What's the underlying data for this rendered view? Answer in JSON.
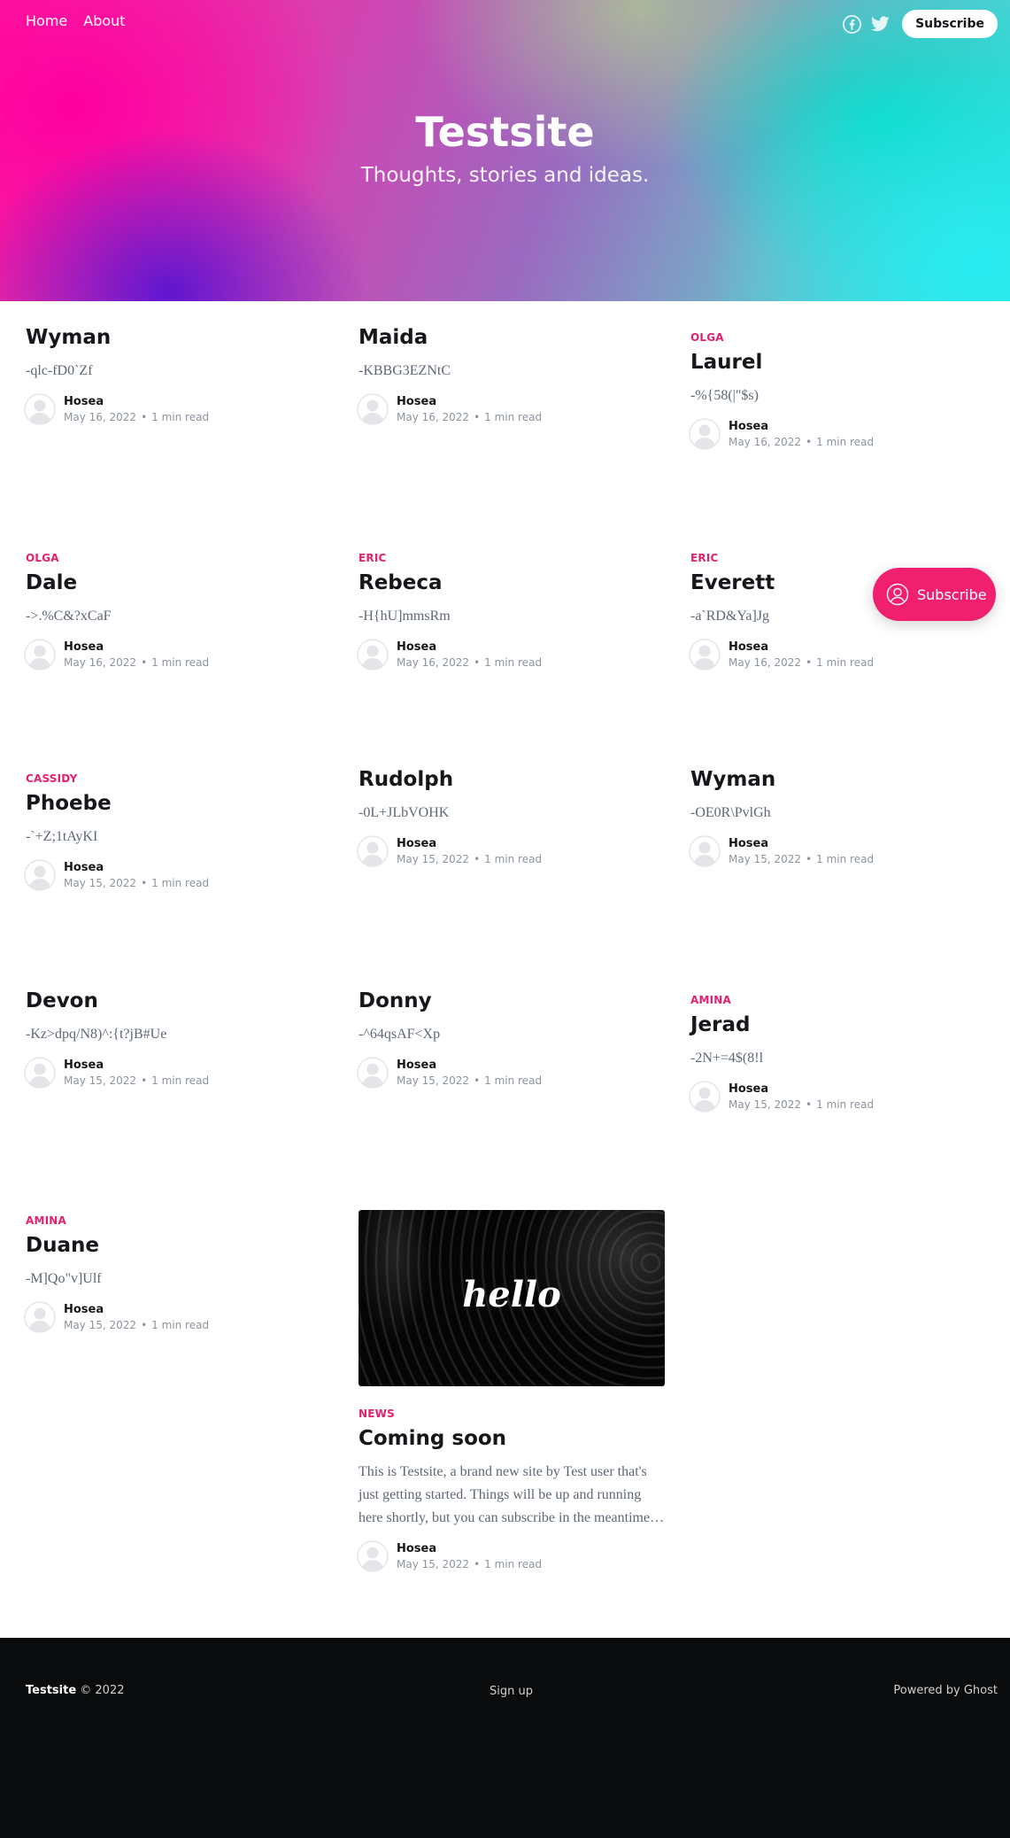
{
  "nav": {
    "home": "Home",
    "about": "About",
    "subscribe": "Subscribe"
  },
  "site": {
    "title": "Testsite",
    "description": "Thoughts, stories and ideas."
  },
  "posts": [
    {
      "tag": "",
      "title": "Wyman",
      "excerpt": "-qlc-fD0`Zf",
      "author": "Hosea",
      "date": "May 16, 2022",
      "read": "1 min read"
    },
    {
      "tag": "",
      "title": "Maida",
      "excerpt": "-KBBG3EZNtC",
      "author": "Hosea",
      "date": "May 16, 2022",
      "read": "1 min read"
    },
    {
      "tag": "Olga",
      "title": "Laurel",
      "excerpt": "-%{58(|\"$s)",
      "author": "Hosea",
      "date": "May 16, 2022",
      "read": "1 min read"
    },
    {
      "tag": "Olga",
      "title": "Dale",
      "excerpt": "->.%C&?xCaF",
      "author": "Hosea",
      "date": "May 16, 2022",
      "read": "1 min read"
    },
    {
      "tag": "Eric",
      "title": "Rebeca",
      "excerpt": "-H{hU]mmsRm",
      "author": "Hosea",
      "date": "May 16, 2022",
      "read": "1 min read"
    },
    {
      "tag": "Eric",
      "title": "Everett",
      "excerpt": "-a`RD&Ya]Jg",
      "author": "Hosea",
      "date": "May 16, 2022",
      "read": "1 min read"
    },
    {
      "tag": "Cassidy",
      "title": "Phoebe",
      "excerpt": "-`+Z;1tAyKI",
      "author": "Hosea",
      "date": "May 15, 2022",
      "read": "1 min read"
    },
    {
      "tag": "",
      "title": "Rudolph",
      "excerpt": "-0L+JLbVOHK",
      "author": "Hosea",
      "date": "May 15, 2022",
      "read": "1 min read"
    },
    {
      "tag": "",
      "title": "Wyman",
      "excerpt": "-OE0R\\PvlGh",
      "author": "Hosea",
      "date": "May 15, 2022",
      "read": "1 min read"
    },
    {
      "tag": "",
      "title": "Devon",
      "excerpt": "-Kz>dpq/N8)^:{t?jB#Ue",
      "author": "Hosea",
      "date": "May 15, 2022",
      "read": "1 min read"
    },
    {
      "tag": "",
      "title": "Donny",
      "excerpt": "-^64qsAF<Xp",
      "author": "Hosea",
      "date": "May 15, 2022",
      "read": "1 min read"
    },
    {
      "tag": "Amina",
      "title": "Jerad",
      "excerpt": "-2N+=4$(8!l",
      "author": "Hosea",
      "date": "May 15, 2022",
      "read": "1 min read"
    },
    {
      "tag": "Amina",
      "title": "Duane",
      "excerpt": "-M]Qo\"v]Ulf",
      "author": "Hosea",
      "date": "May 15, 2022",
      "read": "1 min read"
    },
    {
      "tag": "News",
      "title": "Coming soon",
      "image_text": "hello",
      "excerpt": "This is Testsite, a brand new site by Test user that's just getting started. Things will be up and running here shortly, but you can subscribe in the meantime…",
      "author": "Hosea",
      "date": "May 15, 2022",
      "read": "1 min read"
    }
  ],
  "floating_subscribe": "Subscribe",
  "footer": {
    "site": "Testsite",
    "copyright": "© 2022",
    "signup": "Sign up",
    "powered": "Powered by Ghost"
  },
  "icons": {
    "facebook": "facebook-icon",
    "twitter": "twitter-icon",
    "avatar": "avatar-icon",
    "subscribe": "user-circle-icon"
  },
  "colors": {
    "accent": "#e2216e",
    "float_button": "#f0206f",
    "footer_bg": "#0a0b0c"
  }
}
